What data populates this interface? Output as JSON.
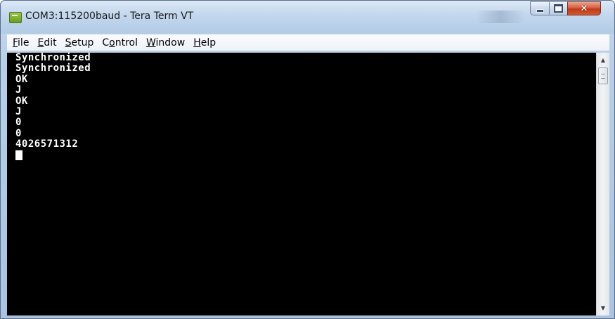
{
  "window": {
    "title": "COM3:115200baud - Tera Term VT",
    "app_icon": "tera-term-app-icon",
    "controls": {
      "minimize_icon": "minimize-icon",
      "maximize_icon": "maximize-icon",
      "close_icon": "close-icon",
      "close_glyph": "✕"
    }
  },
  "menubar": {
    "items": [
      {
        "mnemonic": "F",
        "rest": "ile"
      },
      {
        "mnemonic": "E",
        "rest": "dit"
      },
      {
        "mnemonic": "S",
        "rest": "etup"
      },
      {
        "pre": "C",
        "mnemonic": "o",
        "rest": "ntrol"
      },
      {
        "mnemonic": "W",
        "rest": "indow"
      },
      {
        "mnemonic": "H",
        "rest": "elp"
      }
    ]
  },
  "terminal": {
    "lines": [
      "Synchronized",
      "Synchronized",
      "OK",
      "J",
      "OK",
      "J",
      "0",
      "0",
      "4026571312"
    ],
    "background": "#000000",
    "foreground": "#ffffff"
  },
  "scrollbar": {
    "up_arrow": "▲",
    "down_arrow": "▼"
  },
  "colors": {
    "close_button": "#c2391b",
    "frame": "#b9cfe8"
  }
}
